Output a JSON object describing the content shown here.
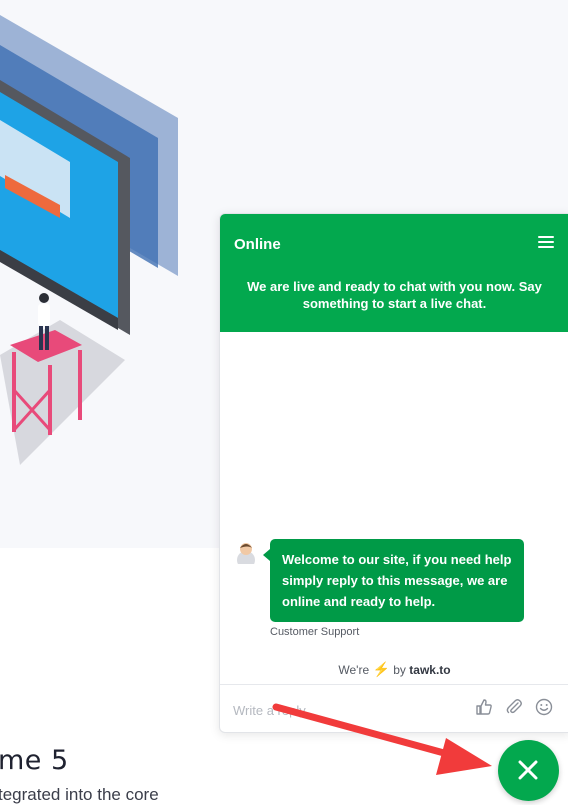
{
  "page": {
    "heading": "me 5",
    "subtext": "tegrated into the core"
  },
  "chat": {
    "status": "Online",
    "intro": "We are live and ready to chat with you now. Say something to start a live chat.",
    "message": "Welcome to our site, if you need help simply reply to this message, we are online and ready to help.",
    "agent_name": "Customer Support",
    "powered_prefix": "We're",
    "powered_by": "by",
    "powered_brand": "tawk.to",
    "reply_placeholder": "Write a reply..",
    "colors": {
      "header": "#03a84e",
      "bubble": "#009a47"
    }
  },
  "icons": {
    "menu": "hamburger-menu-icon",
    "like": "thumbs-up-icon",
    "attach": "paperclip-icon",
    "emoji": "smiley-icon",
    "close": "close-icon",
    "bolt": "lightning-bolt-icon"
  },
  "annotation": {
    "arrow_color": "#f13b3b"
  }
}
